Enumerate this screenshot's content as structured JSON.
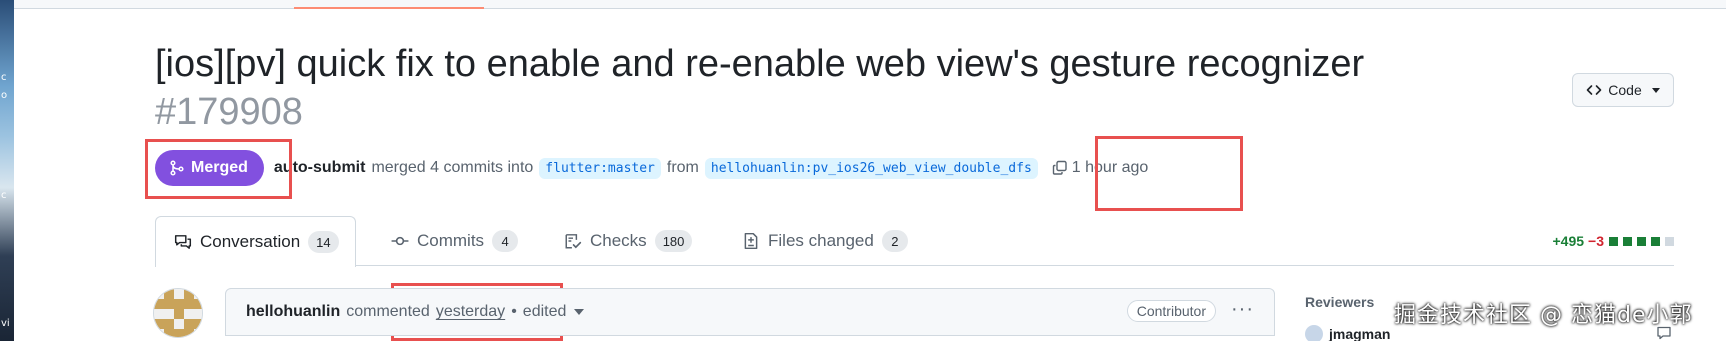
{
  "desktop": {
    "edge_labels": [
      "c",
      "o",
      "c",
      "vi"
    ]
  },
  "pr": {
    "title": "[ios][pv] quick fix to enable and re-enable web view's gesture recognizer",
    "number": "#179908",
    "state": "Merged",
    "author": "auto-submit",
    "merge_text": "merged 4 commits into",
    "base_branch": "flutter:master",
    "from_text": "from",
    "head_branch": "hellohuanlin:pv_ios26_web_view_double_dfs",
    "time": "1 hour ago",
    "colors": {
      "merged": "#8250df",
      "highlight": "#e8504f",
      "additions": "#1a7f37",
      "deletions": "#d1242f"
    }
  },
  "code_button": {
    "label": "Code"
  },
  "tabs": [
    {
      "label": "Conversation",
      "count": "14",
      "icon": "comment-discussion-icon",
      "active": true
    },
    {
      "label": "Commits",
      "count": "4",
      "icon": "git-commit-icon",
      "active": false
    },
    {
      "label": "Checks",
      "count": "180",
      "icon": "checklist-icon",
      "active": false
    },
    {
      "label": "Files changed",
      "count": "2",
      "icon": "file-diff-icon",
      "active": false
    }
  ],
  "diffstat": {
    "additions": "+495",
    "deletions": "−3"
  },
  "comment": {
    "author": "hellohuanlin",
    "action": "commented",
    "when": "yesterday",
    "separator": "•",
    "edited": "edited",
    "role": "Contributor"
  },
  "sidebar": {
    "reviewers_label": "Reviewers",
    "first_reviewer": "jmagman"
  },
  "watermark": "掘金技术社区 @ 恋猫de小郭"
}
